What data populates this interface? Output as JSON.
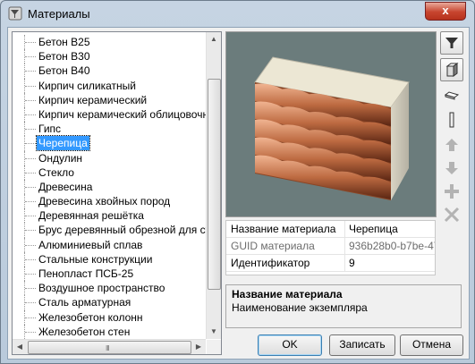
{
  "window": {
    "title": "Материалы",
    "close_label": "x"
  },
  "materials_list": {
    "items": [
      "Бетон B25",
      "Бетон B30",
      "Бетон B40",
      "Кирпич силикатный",
      "Кирпич керамический",
      "Кирпич керамический облицовочный",
      "Гипс",
      "Черепица",
      "Ондулин",
      "Стекло",
      "Древесина",
      "Древесина хвойных пород",
      "Деревянная решётка",
      "Брус деревянный обрезной для стен",
      "Алюминиевый сплав",
      "Стальные конструкции",
      "Пенопласт ПСБ-25",
      "Воздушное пространство",
      "Сталь арматурная",
      "Железобетон колонн",
      "Железобетон стен"
    ],
    "selected": "Черепица",
    "hscroll_grip": "III"
  },
  "properties": {
    "header_name": "Название материала",
    "header_value": "Черепица",
    "rows": [
      {
        "name": "GUID материала",
        "value": "936b28b0-b7be-47..."
      },
      {
        "name": "Идентификатор",
        "value": "9"
      }
    ]
  },
  "description": {
    "title": "Название материала",
    "text": "Наименование экземпляра"
  },
  "toolbar": {
    "icons": [
      "filter-icon",
      "cube-icon",
      "slab-icon",
      "column-icon",
      "move-up-icon",
      "move-down-icon",
      "add-icon",
      "delete-icon"
    ]
  },
  "buttons": {
    "ok": "OK",
    "save": "Записать",
    "cancel": "Отмена"
  },
  "colors": {
    "selection": "#3399ff",
    "preview_bg": "#6b7c7c",
    "tile": "#b5663d"
  }
}
